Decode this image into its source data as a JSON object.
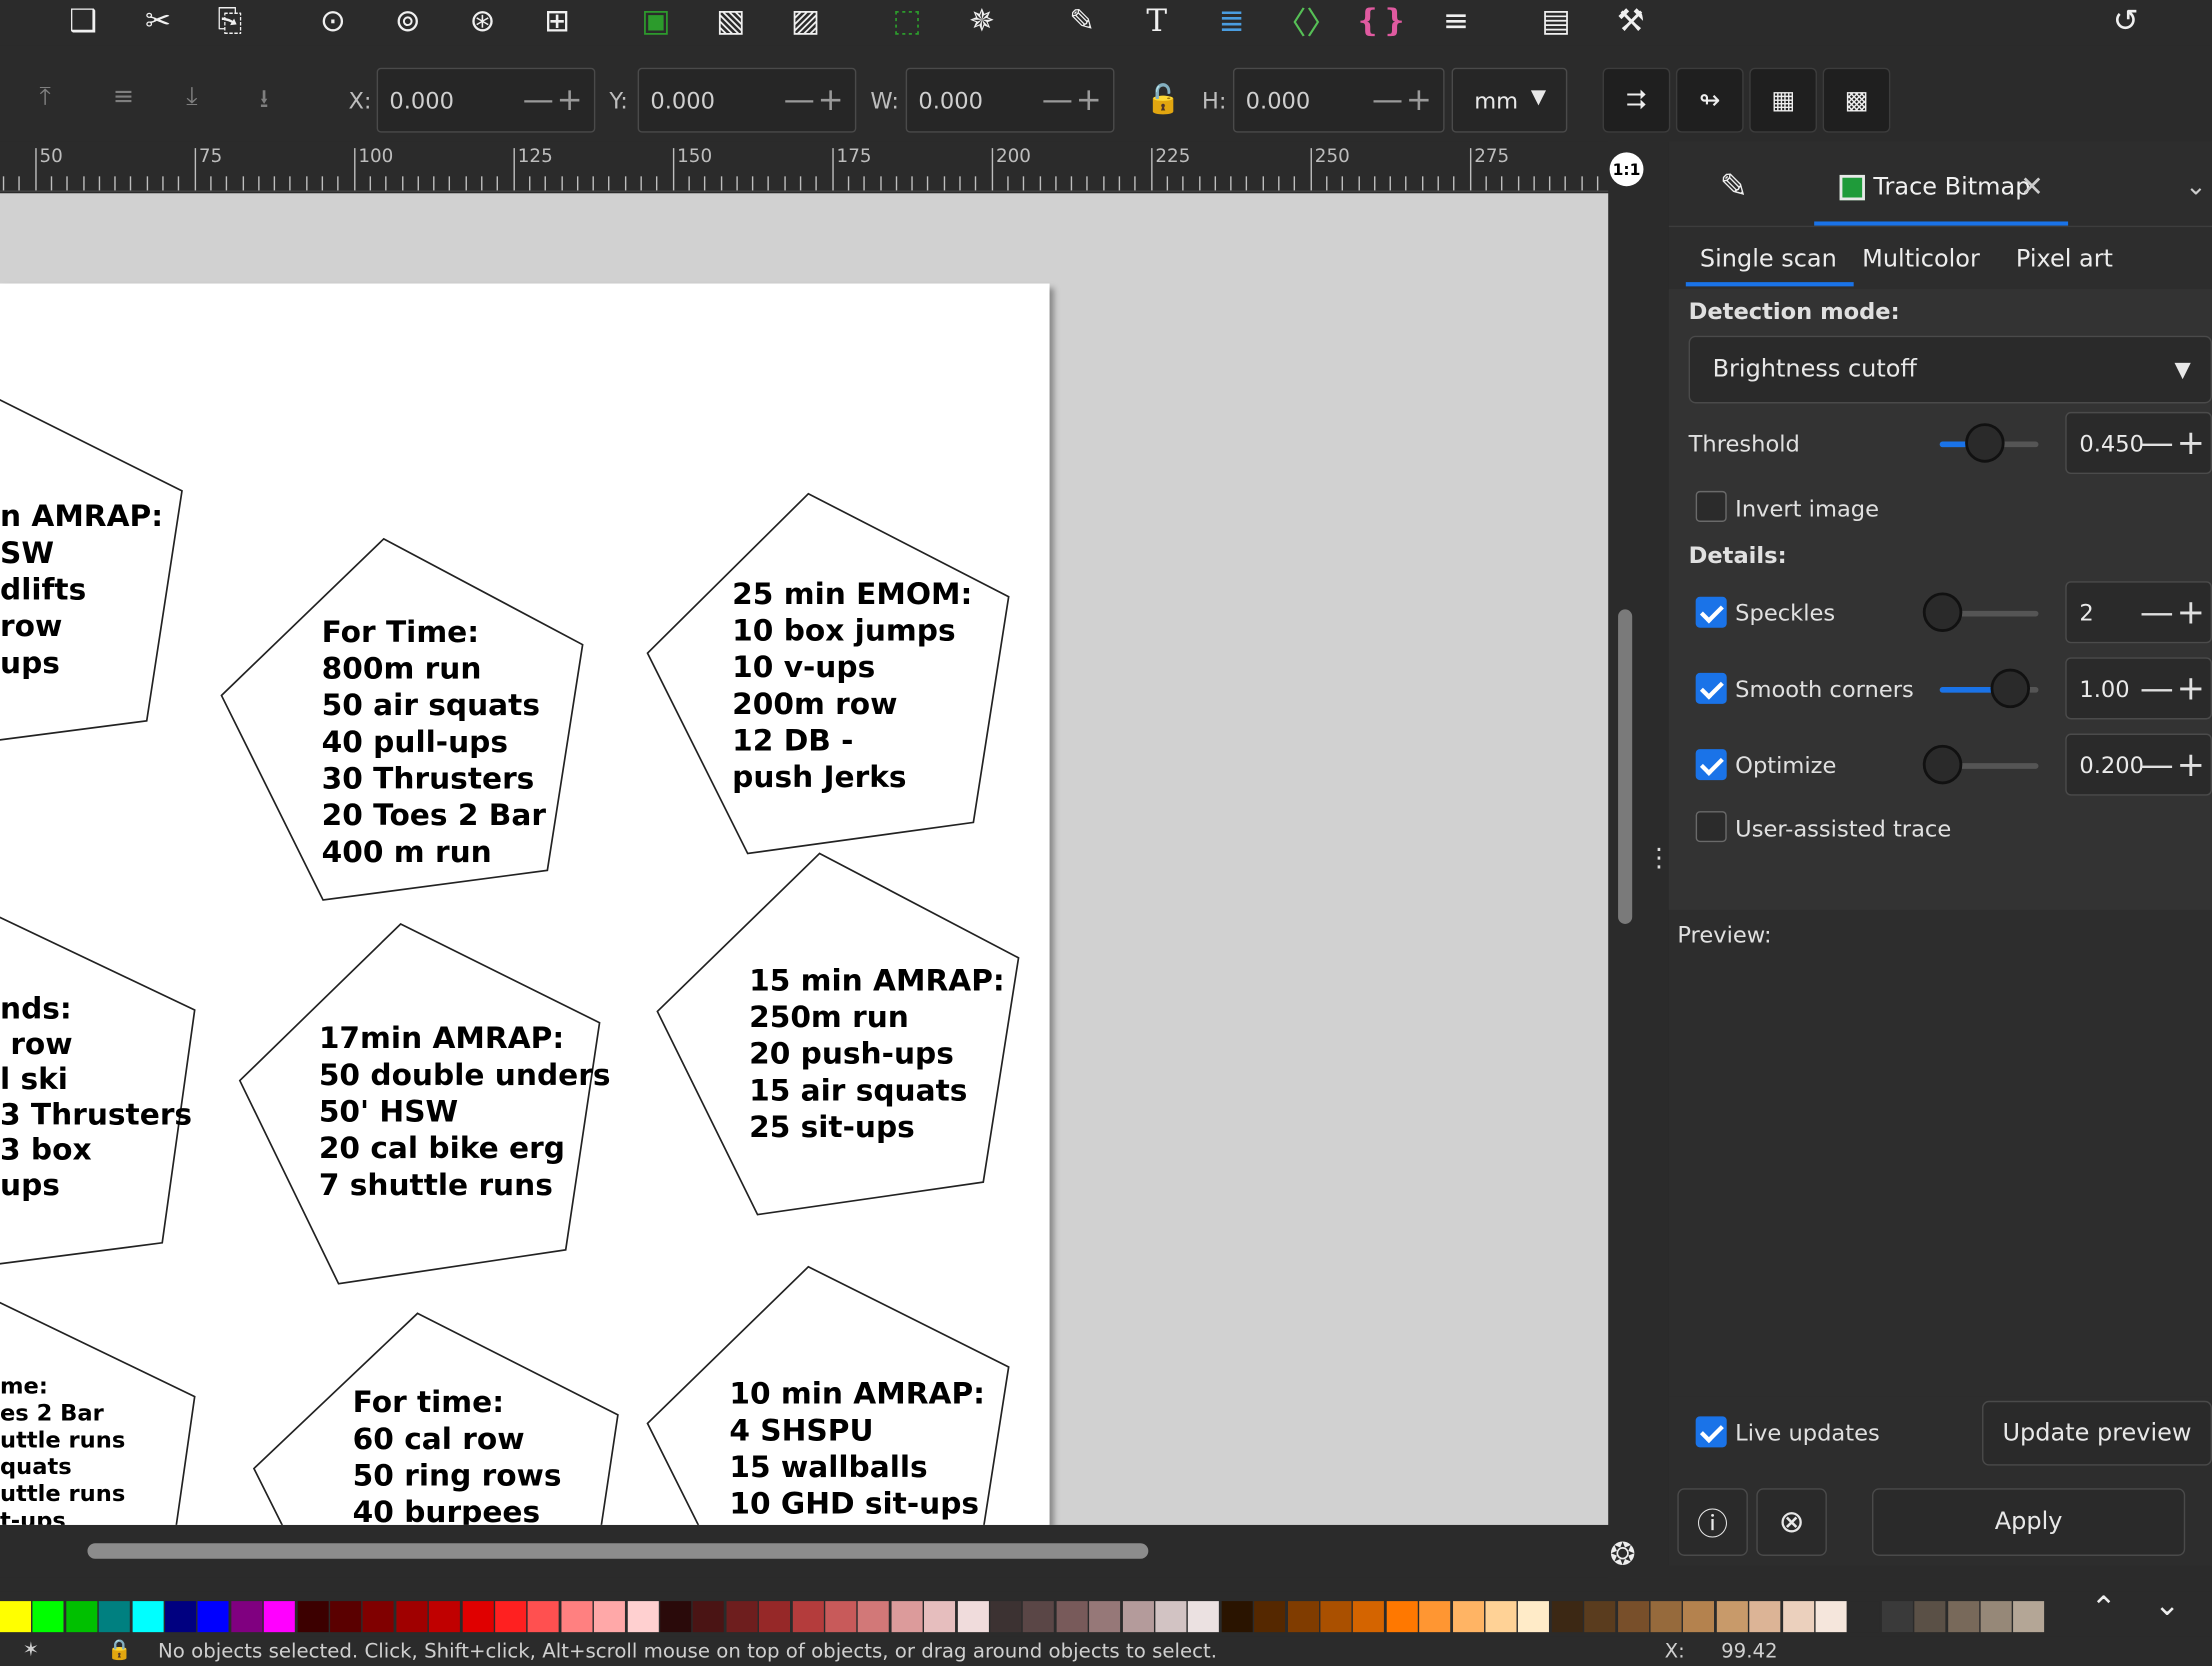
{
  "app": "Inkscape",
  "toolbar_top": {
    "icons": [
      "duplicate-icon",
      "cut-icon",
      "paste-icon",
      "zoom-selection-icon",
      "zoom-drawing-icon",
      "zoom-page-icon",
      "zoom-center-icon",
      "raise-icon",
      "lock-icon",
      "group-icon",
      "node-snap-icon",
      "bbox-snap-icon",
      "pen-icon",
      "text-icon",
      "xml-editor-icon",
      "object-properties-icon",
      "selectors-icon",
      "align-icon",
      "document-properties-icon",
      "preferences-icon",
      "undo-icon"
    ]
  },
  "toolbar_props": {
    "x_label": "X:",
    "x_value": "0.000",
    "y_label": "Y:",
    "y_value": "0.000",
    "w_label": "W:",
    "w_value": "0.000",
    "h_label": "H:",
    "h_value": "0.000",
    "unit": "mm"
  },
  "ruler": {
    "ticks": [
      "50",
      "75",
      "100",
      "125",
      "150",
      "175",
      "200",
      "225",
      "250",
      "275"
    ],
    "zoom_label": "1:1"
  },
  "cards": [
    {
      "text": "n AMRAP:\nSW\ndlifts\nrow\nups"
    },
    {
      "text": "For Time:\n800m run\n50 air squats\n40 pull-ups\n30 Thrusters\n20 Toes 2 Bar\n400 m run"
    },
    {
      "text": "25 min EMOM:\n10 box jumps\n10 v-ups\n200m row\n12 DB -\npush Jerks"
    },
    {
      "text": "nds:\n row\nl ski\n3 Thrusters\n3 box\nups"
    },
    {
      "text": "17min AMRAP:\n50 double unders\n50' HSW\n20 cal bike erg\n7 shuttle runs"
    },
    {
      "text": "15 min AMRAP:\n250m run\n20 push-ups\n15 air squats\n25 sit-ups"
    },
    {
      "text": "me:\nes 2 Bar\nuttle runs\nquats\nuttle runs\nt-ups"
    },
    {
      "text": "For time:\n60 cal row\n50 ring rows\n40 burpees"
    },
    {
      "text": "10 min AMRAP:\n4 SHSPU\n15 wallballs\n10 GHD sit-ups"
    }
  ],
  "panel": {
    "dialog_tab": "Trace Bitmap",
    "subtabs": [
      "Single scan",
      "Multicolor",
      "Pixel art"
    ],
    "detection_mode_label": "Detection mode:",
    "detection_mode_value": "Brightness cutoff",
    "threshold_label": "Threshold",
    "threshold_value": "0.450",
    "threshold_level": 0.45,
    "invert_label": "Invert image",
    "details_label": "Details:",
    "speckles_label": "Speckles",
    "speckles_value": "2",
    "smooth_label": "Smooth corners",
    "smooth_value": "1.00",
    "optimize_label": "Optimize",
    "optimize_value": "0.200",
    "user_assisted_label": "User-assisted trace",
    "preview_label": "Preview:",
    "live_updates_label": "Live updates",
    "update_preview_label": "Update preview",
    "apply_label": "Apply"
  },
  "palette": [
    "#ffff00",
    "#00ff00",
    "#00c000",
    "#008080",
    "#00ffff",
    "#000080",
    "#0000ff",
    "#800080",
    "#ff00ff",
    "#3c0000",
    "#5a0000",
    "#800000",
    "#a00000",
    "#c00000",
    "#e00000",
    "#ff2020",
    "#ff5050",
    "#ff8080",
    "#ffa8a8",
    "#ffd0d0",
    "#2a0a0a",
    "#4a1414",
    "#6e1e1e",
    "#962828",
    "#b43c3c",
    "#c85a5a",
    "#d27878",
    "#dc9b9b",
    "#e6bebe",
    "#f0dcdc",
    "#3c3232",
    "#5a4646",
    "#785a5a",
    "#967878",
    "#b49b9b",
    "#d2c3c3",
    "#ebe1e1",
    "#2a1400",
    "#552800",
    "#803c00",
    "#aa5000",
    "#d46400",
    "#ff7800",
    "#ff9632",
    "#ffb464",
    "#ffd296",
    "#ffebc8",
    "#3c2814",
    "#5a3c1e",
    "#784f2a",
    "#966a3c",
    "#b4824e",
    "#c89a6a",
    "#dcb496",
    "#ebd0bd",
    "#f5e6dc",
    "#2b2b2b",
    "#3a3a3a",
    "#5a5046",
    "#78695a",
    "#968878",
    "#b4a696"
  ],
  "status": {
    "message": "No objects selected. Click, Shift+click, Alt+scroll mouse on top of objects, or drag around objects to select.",
    "x_label": "X:",
    "x_value": "99.42"
  }
}
